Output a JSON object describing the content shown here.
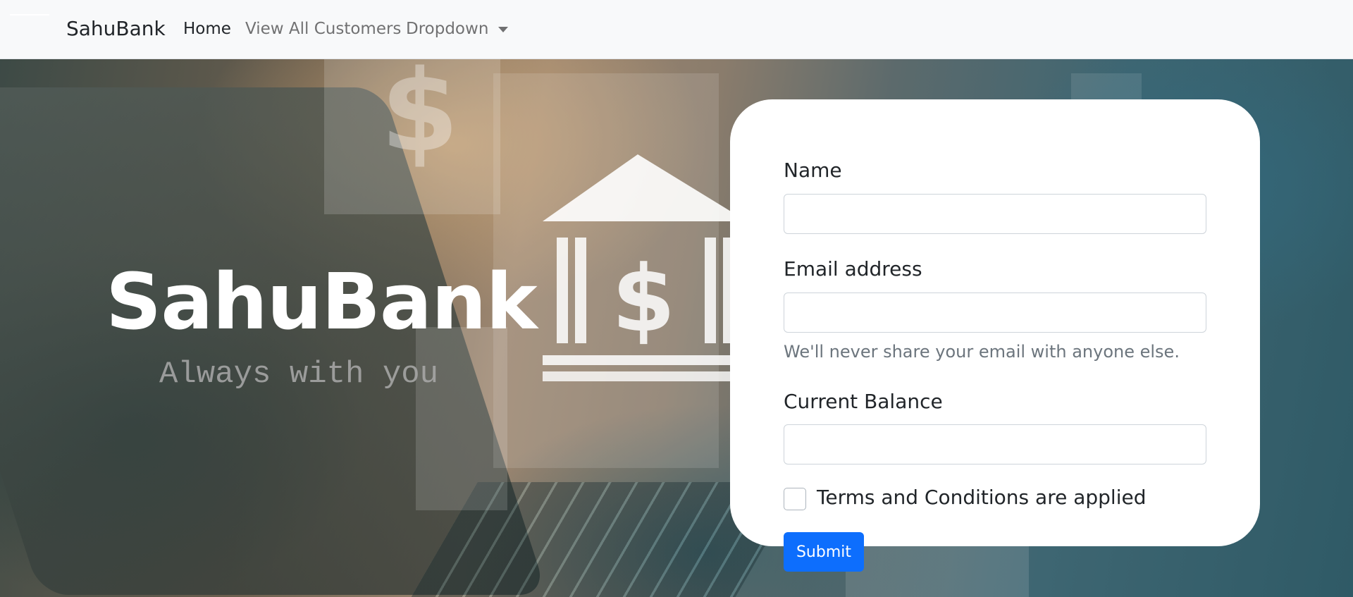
{
  "navbar": {
    "brand": "SahuBank",
    "links": [
      {
        "label": "Home"
      },
      {
        "label": "View All Customers"
      },
      {
        "label": "Dropdown"
      }
    ]
  },
  "hero": {
    "title": "SahuBank",
    "subtitle": "Always with you"
  },
  "form": {
    "name_label": "Name",
    "name_value": "",
    "email_label": "Email address",
    "email_value": "",
    "email_help": "We'll never share your email with anyone else.",
    "balance_label": "Current Balance",
    "balance_value": "",
    "terms_label": "Terms and Conditions are applied",
    "terms_checked": false,
    "submit_label": "Submit"
  },
  "colors": {
    "primary": "#0d6efd",
    "navbar_bg": "#f8f9fa",
    "card_bg": "#ffffff"
  },
  "icons": [
    "dollar-icon",
    "bank-icon",
    "caret-down-icon"
  ]
}
